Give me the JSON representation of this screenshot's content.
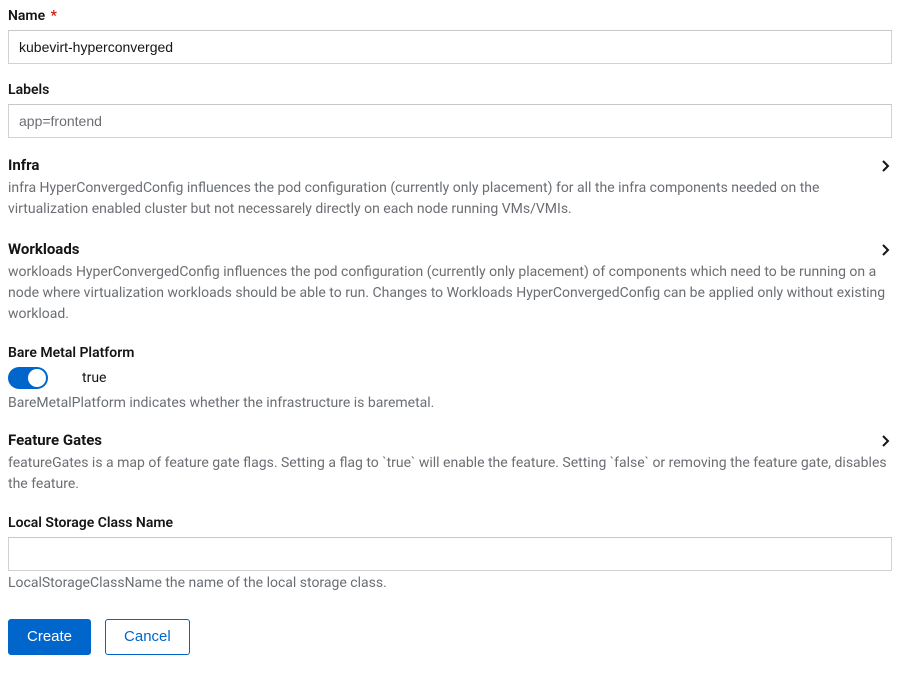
{
  "name": {
    "label": "Name",
    "value": "kubevirt-hyperconverged"
  },
  "labels": {
    "label": "Labels",
    "placeholder": "app=frontend",
    "value": ""
  },
  "infra": {
    "title": "Infra",
    "description": "infra HyperConvergedConfig influences the pod configuration (currently only placement) for all the infra components needed on the virtualization enabled cluster but not necessarely directly on each node running VMs/VMIs."
  },
  "workloads": {
    "title": "Workloads",
    "description": "workloads HyperConvergedConfig influences the pod configuration (currently only placement) of components which need to be running on a node where virtualization workloads should be able to run. Changes to Workloads HyperConvergedConfig can be applied only without existing workload."
  },
  "bareMetal": {
    "title": "Bare Metal Platform",
    "value": "true",
    "description": "BareMetalPlatform indicates whether the infrastructure is baremetal."
  },
  "featureGates": {
    "title": "Feature Gates",
    "description": "featureGates is a map of feature gate flags. Setting a flag to `true` will enable the feature. Setting `false` or removing the feature gate, disables the feature."
  },
  "localStorage": {
    "title": "Local Storage Class Name",
    "value": "",
    "description": "LocalStorageClassName the name of the local storage class."
  },
  "buttons": {
    "create": "Create",
    "cancel": "Cancel"
  }
}
